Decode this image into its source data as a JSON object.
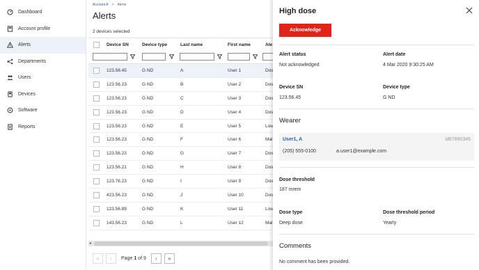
{
  "sidebar": {
    "items": [
      {
        "label": "Dashboard",
        "icon": "dashboard-icon"
      },
      {
        "label": "Account profile",
        "icon": "account-icon"
      },
      {
        "label": "Alerts",
        "icon": "warning-icon",
        "active": true
      },
      {
        "label": "Departments",
        "icon": "departments-icon"
      },
      {
        "label": "Users",
        "icon": "users-icon"
      },
      {
        "label": "Devices",
        "icon": "devices-icon"
      },
      {
        "label": "Software",
        "icon": "software-icon"
      },
      {
        "label": "Reports",
        "icon": "reports-icon"
      }
    ]
  },
  "main": {
    "breadcrumb": {
      "parent": "Account A",
      "separator": ">",
      "current": "Alerts"
    },
    "title": "Alerts",
    "selected_count": "2 devices selected",
    "columns": [
      "Device SN",
      "Device type",
      "Last name",
      "First name",
      "Ale"
    ],
    "rows": [
      {
        "sn": "123.56.45",
        "type": "G ND",
        "last": "A",
        "first": "User 1",
        "alert": "Dos",
        "selected": true
      },
      {
        "sn": "123.56.23",
        "type": "G ND",
        "last": "B",
        "first": "User 2",
        "alert": "Dos"
      },
      {
        "sn": "123.56.23",
        "type": "G ND",
        "last": "C",
        "first": "User 3",
        "alert": "Dos"
      },
      {
        "sn": "123.56.23",
        "type": "G ND",
        "last": "D",
        "first": "User 4",
        "alert": "Dos"
      },
      {
        "sn": "123.56.23",
        "type": "G ND",
        "last": "E",
        "first": "User 5",
        "alert": "Low"
      },
      {
        "sn": "123.56.23",
        "type": "G ND",
        "last": "F",
        "first": "User 6",
        "alert": "Mal"
      },
      {
        "sn": "123.56.23",
        "type": "G ND",
        "last": "G",
        "first": "User 7",
        "alert": "Dos"
      },
      {
        "sn": "123.56.21",
        "type": "G ND",
        "last": "H",
        "first": "User 8",
        "alert": "Dos"
      },
      {
        "sn": "123.76.23",
        "type": "G ND",
        "last": "I",
        "first": "User 9",
        "alert": "Dos"
      },
      {
        "sn": "423.56.23",
        "type": "G ND",
        "last": "J",
        "first": "User 10",
        "alert": "Dos"
      },
      {
        "sn": "123.56.89",
        "type": "G ND",
        "last": "K",
        "first": "User 11",
        "alert": "Low"
      },
      {
        "sn": "143.56.23",
        "type": "G ND",
        "last": "L",
        "first": "User 12",
        "alert": "Mal"
      }
    ],
    "pager": {
      "prefix": "Page",
      "current": "1",
      "middle": "of",
      "total": "9"
    }
  },
  "panel": {
    "title": "High dose",
    "ack_label": "Acknowledge",
    "alert_status_label": "Alert status",
    "alert_status": "Not acknowledged",
    "alert_date_label": "Alert date",
    "alert_date": "4 Mar 2020  9:30:25 AM",
    "device_sn_label": "Device SN",
    "device_sn": "123.56.45",
    "device_type_label": "Device type",
    "device_type": "G ND",
    "wearer_title": "Wearer",
    "wearer": {
      "name": "User1, A",
      "id": "id67890345",
      "phone": "(205) 555-0100",
      "email": "a.user1@example.com"
    },
    "dose_threshold_label": "Dose threshold",
    "dose_threshold": "187 mrem",
    "dose_type_label": "Dose type",
    "dose_type": "Deep dose",
    "dose_period_label": "Dose threshold period",
    "dose_period": "Yearly",
    "comments_title": "Comments",
    "comments": "No comment has been provided."
  },
  "colors": {
    "accent": "#e2231a",
    "link": "#2a5db0",
    "selected_row": "#eef2fa"
  }
}
